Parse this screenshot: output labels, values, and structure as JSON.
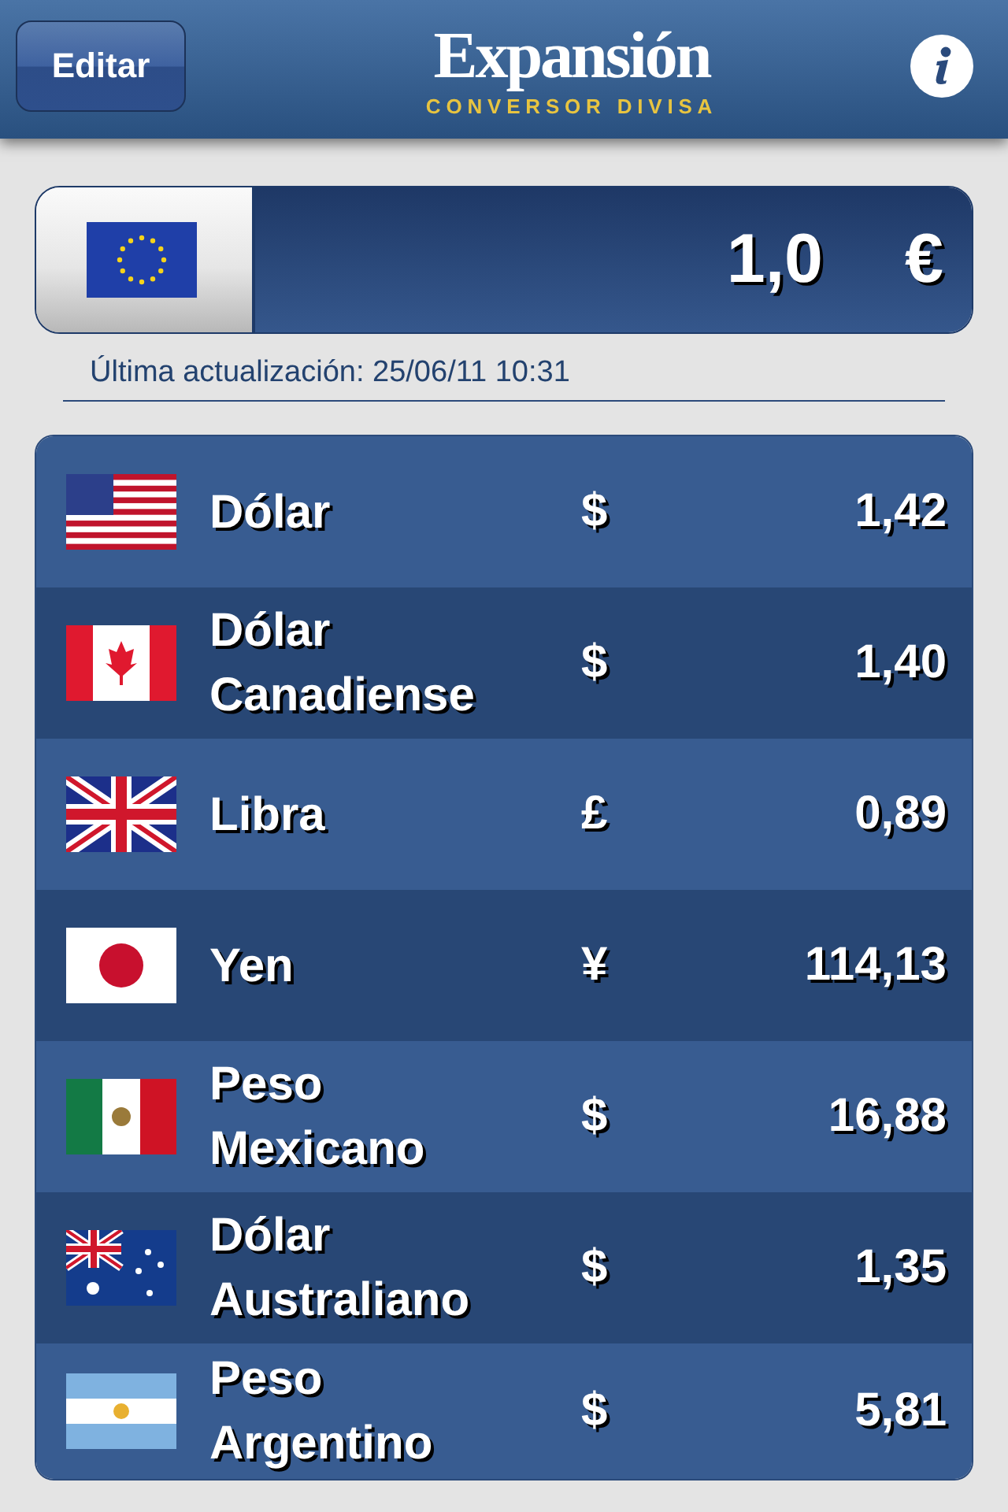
{
  "header": {
    "edit_button": "Editar",
    "logo": "Expansión",
    "subtitle": "CONVERSOR DIVISA"
  },
  "amount": {
    "value": "1,0",
    "symbol": "€"
  },
  "last_update": "Última actualización: 25/06/11 10:31",
  "currencies": [
    {
      "kind": "us",
      "name": "Dólar",
      "symbol": "$",
      "rate": "1,42"
    },
    {
      "kind": "ca",
      "name": "Dólar Canadiense",
      "symbol": "$",
      "rate": "1,40"
    },
    {
      "kind": "uk",
      "name": "Libra",
      "symbol": "£",
      "rate": "0,89"
    },
    {
      "kind": "jp",
      "name": "Yen",
      "symbol": "¥",
      "rate": "114,13"
    },
    {
      "kind": "mx",
      "name": "Peso Mexicano",
      "symbol": "$",
      "rate": "16,88"
    },
    {
      "kind": "au",
      "name": "Dólar Australiano",
      "symbol": "$",
      "rate": "1,35"
    },
    {
      "kind": "ar",
      "name": "Peso Argentino",
      "symbol": "$",
      "rate": "5,81"
    }
  ]
}
